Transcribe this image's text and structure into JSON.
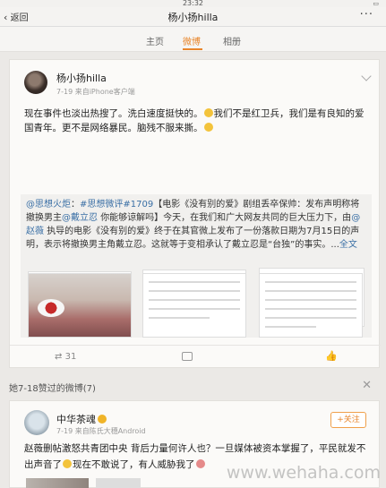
{
  "status_bar": {
    "time": "23:32"
  },
  "nav": {
    "back_label": "返回",
    "title": "杨小扬hilla",
    "more": "···"
  },
  "tabs": [
    {
      "label": "主页"
    },
    {
      "label": "微博",
      "active": true
    },
    {
      "label": "相册"
    }
  ],
  "post": {
    "username": "杨小扬hilla",
    "date": "7-19",
    "source": "来自iPhone客户端",
    "text_lines": [
      "现在事件也淡出热搜了。洗白速度挺快的。",
      "我们不是红卫兵，我们是有良知的爱国青年。更不是网络暴民。脑残不服来撕。"
    ],
    "repost_text": {
      "prefix_user": "@思想火炬",
      "topic": "#思想微评#1709",
      "part1": "【电影《没有别的爱》剧组丢卒保帅：发布声明称将撤换男主",
      "mention": "@戴立忍",
      "part2": "你能够谅解吗】今天，在我们和广大网友共同的巨大压力下，由",
      "mention2": "@赵薇",
      "part3": "执导的电影《没有别的爱》终于在其官微上发布了一份落款日期为7月15日的声明，表示将撤换男主角戴立忍。这就等于变相承认了戴立忍是“台独”的事实。...",
      "full_text_link": "全文"
    },
    "actions": {
      "repost_count": "31"
    }
  },
  "section": {
    "title": "她7-18赞过的微博(7)",
    "close": "✕"
  },
  "post2": {
    "username": "中华茶魂",
    "date": "7-19",
    "source": "来自陈氏大穗Android",
    "follow_label": "+关注",
    "text": "赵薇删帖激怒共青团中央 背后力量何许人也？一旦媒体被资本掌握了，平民就发不出声音了",
    "text2": "现在不敢说了，有人威胁我了"
  },
  "watermark": "www.wehaha.com",
  "colors": {
    "accent": "#e8862c",
    "link": "#3a6fa5"
  }
}
